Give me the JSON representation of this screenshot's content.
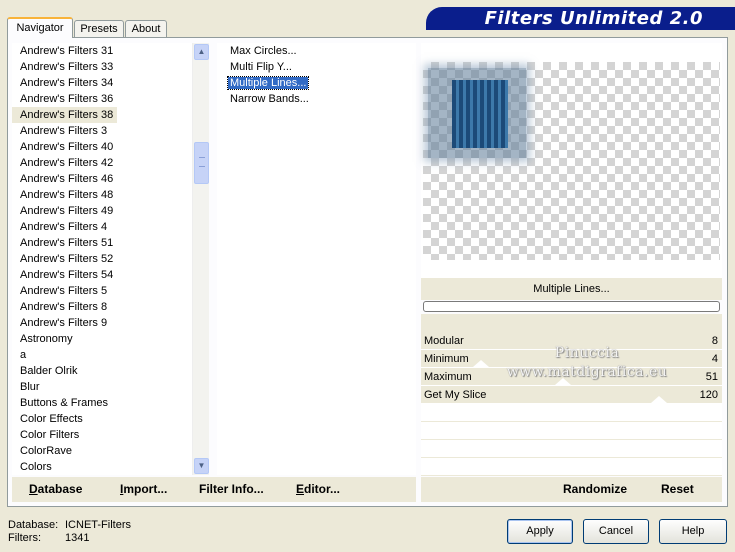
{
  "tabs": [
    {
      "label": "Navigator",
      "active": true
    },
    {
      "label": "Presets",
      "active": false
    },
    {
      "label": "About",
      "active": false
    }
  ],
  "banner_title": "Filters Unlimited 2.0",
  "categories": [
    "Andrew's Filters 31",
    "Andrew's Filters 33",
    "Andrew's Filters 34",
    "Andrew's Filters 36",
    "Andrew's Filters 38",
    "Andrew's Filters 3",
    "Andrew's Filters 40",
    "Andrew's Filters 42",
    "Andrew's Filters 46",
    "Andrew's Filters 48",
    "Andrew's Filters 49",
    "Andrew's Filters 4",
    "Andrew's Filters 51",
    "Andrew's Filters 52",
    "Andrew's Filters 54",
    "Andrew's Filters 5",
    "Andrew's Filters 8",
    "Andrew's Filters 9",
    "Astronomy",
    "a",
    "Balder Olrik",
    "Blur",
    "Buttons & Frames",
    "Color Effects",
    "Color Filters",
    "ColorRave",
    "Colors"
  ],
  "selected_category": "Andrew's Filters 38",
  "filters": [
    "Max Circles...",
    "Multi Flip Y...",
    "Multiple Lines...",
    "Narrow Bands..."
  ],
  "selected_filter": "Multiple Lines...",
  "preview_filter_name": "Multiple Lines...",
  "parameters": [
    {
      "name": "Modular",
      "value": "8"
    },
    {
      "name": "Minimum",
      "value": "4"
    },
    {
      "name": "Maximum",
      "value": "51"
    },
    {
      "name": "Get My Slice",
      "value": "120"
    }
  ],
  "left_buttons": {
    "database": "Database",
    "import": "Import...",
    "filter_info": "Filter Info...",
    "editor": "Editor..."
  },
  "right_buttons": {
    "randomize": "Randomize",
    "reset": "Reset"
  },
  "status": {
    "database_label": "Database:",
    "database_value": "ICNET-Filters",
    "filters_label": "Filters:",
    "filters_value": "1341"
  },
  "dialog_buttons": {
    "apply": "Apply",
    "cancel": "Cancel",
    "help": "Help"
  },
  "watermark": {
    "line1": "Pinuccia",
    "line2": "www.matdigrafica.eu"
  },
  "colors": {
    "banner_bg": "#0a1e8c",
    "selection": "#316ac5",
    "panel_bg": "#ece9d8"
  }
}
